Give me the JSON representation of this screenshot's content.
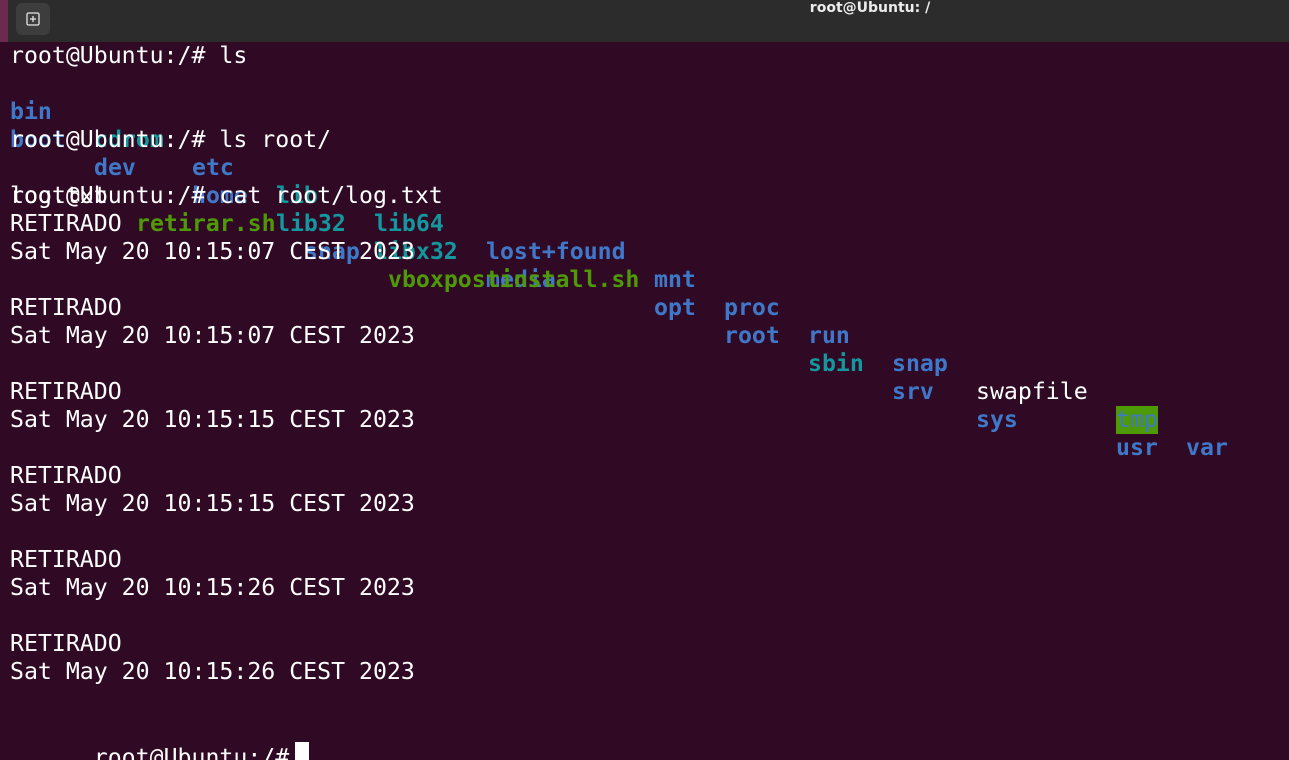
{
  "window": {
    "title": "root@Ubuntu: /"
  },
  "terminal": {
    "commands": {
      "ls": "root@Ubuntu:/# ls",
      "ls_root": "root@Ubuntu:/# ls root/",
      "cat_log": "root@Ubuntu:/# cat root/log.txt",
      "prompt": "root@Ubuntu:/#"
    },
    "ls_output": {
      "row1": [
        "bin",
        "cdrom",
        "etc",
        "lib",
        "lib64",
        "lost+found",
        "mnt",
        "proc",
        "run",
        "snap",
        "swapfile",
        "tmp",
        "var"
      ],
      "row2": [
        "boot",
        "dev",
        "home",
        "lib32",
        "libx32",
        "media",
        "opt",
        "root",
        "sbin",
        "srv",
        "sys",
        "usr"
      ]
    },
    "ls_root_output": [
      "log.txt",
      "retirar.sh",
      "snap",
      "vboxpostinstall.sh"
    ],
    "log_entries": [
      {
        "status": "RETIRADO",
        "date": "Sat May 20 10:15:07 CEST 2023"
      },
      {
        "status": "RETIRADO",
        "date": "Sat May 20 10:15:07 CEST 2023"
      },
      {
        "status": "RETIRADO",
        "date": "Sat May 20 10:15:15 CEST 2023"
      },
      {
        "status": "RETIRADO",
        "date": "Sat May 20 10:15:15 CEST 2023"
      },
      {
        "status": "RETIRADO",
        "date": "Sat May 20 10:15:26 CEST 2023"
      },
      {
        "status": "RETIRADO",
        "date": "Sat May 20 10:15:26 CEST 2023"
      }
    ],
    "colors": {
      "background": "#300a24",
      "titlebar": "#2c2c2c",
      "directory": "#3f78c9",
      "symlink": "#12989e",
      "executable": "#4e9a06",
      "text": "#ffffff"
    }
  },
  "icons": {
    "new_tab": "new-tab-icon"
  }
}
